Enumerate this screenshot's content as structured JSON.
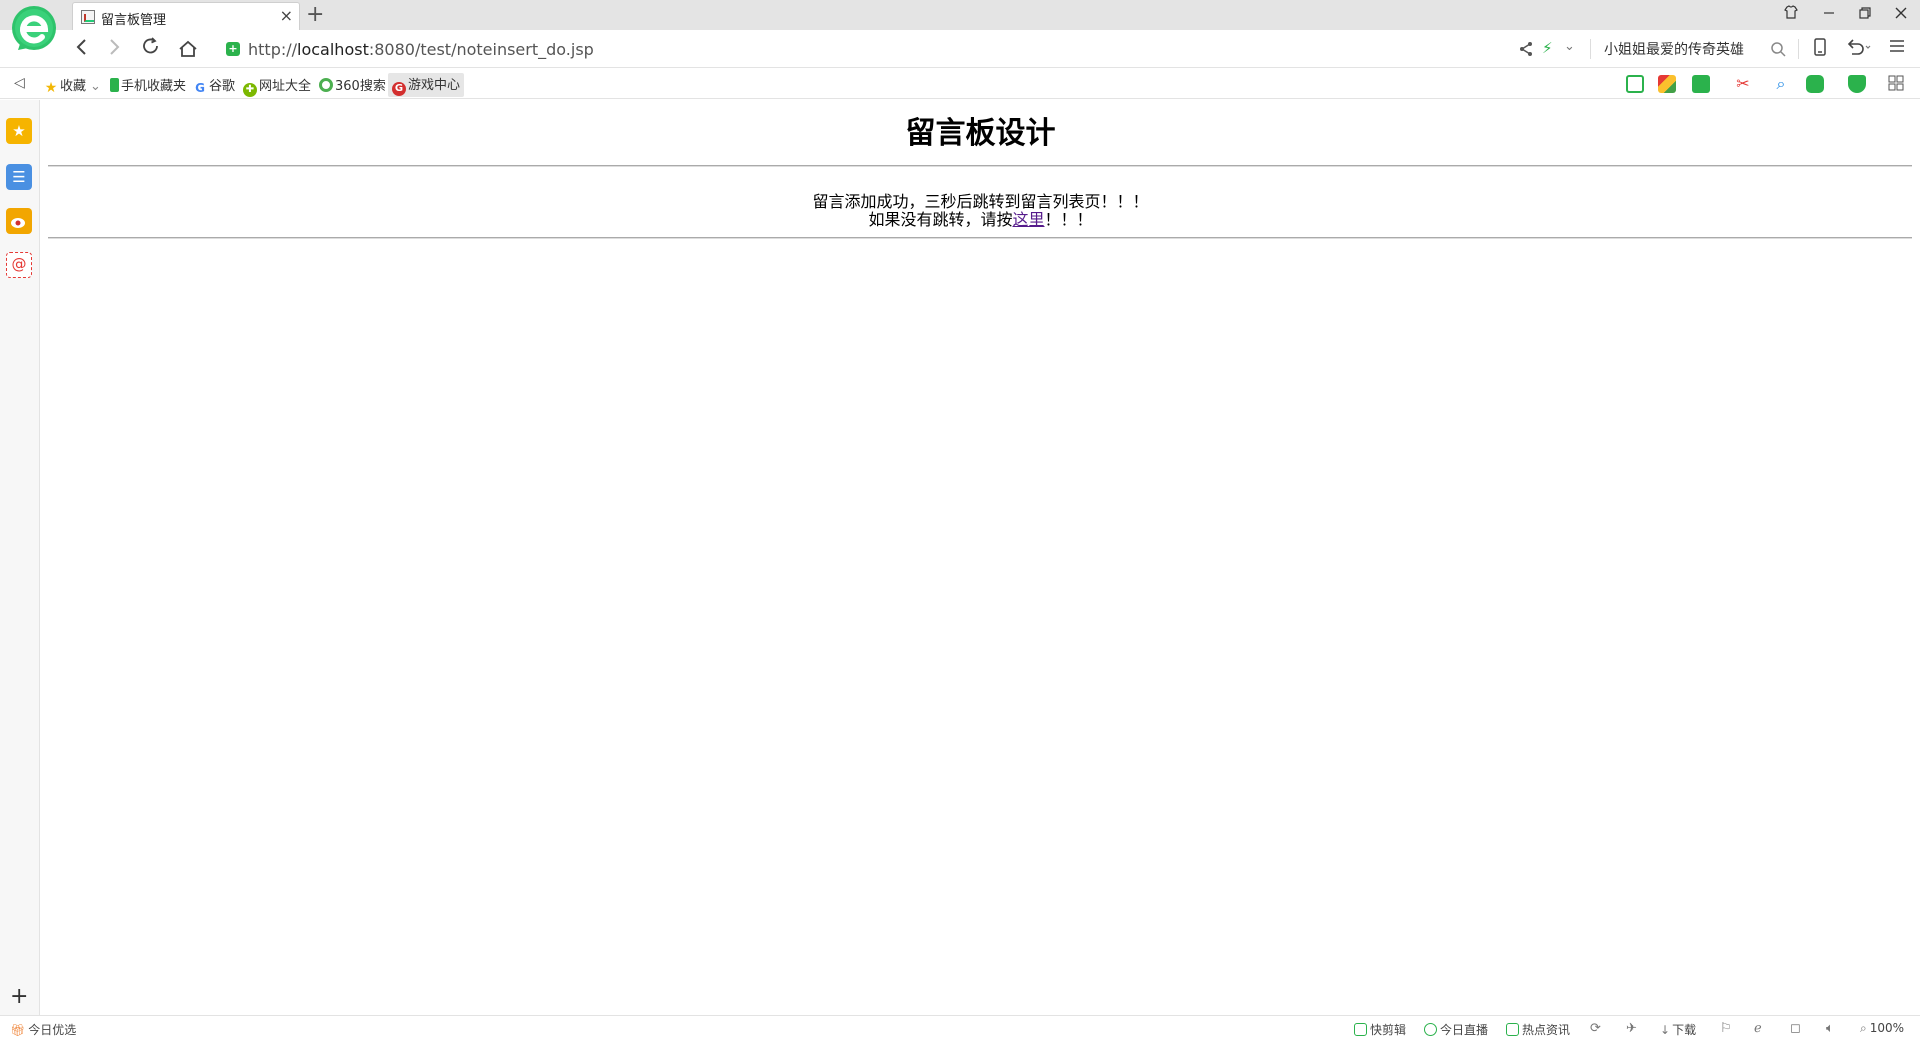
{
  "browser": {
    "tab_title": "留言板管理",
    "tab_close": "×",
    "new_tab": "+",
    "url_prefix": "http://",
    "url_host": "localhost",
    "url_rest": ":8080/test/noteinsert_do.jsp",
    "search_text": "小姐姐最爱的传奇英雄",
    "accent_color": "#2bb24c"
  },
  "bookmarks": {
    "items": [
      "收藏",
      "手机收藏夹",
      "谷歌",
      "网址大全",
      "360搜索",
      "游戏中心"
    ]
  },
  "page": {
    "title": "留言板设计",
    "message_line1": "留言添加成功，三秒后跳转到留言列表页！！！",
    "message_line2_before": "如果没有跳转，请按",
    "message_link": "这里",
    "message_line2_after": "！！！"
  },
  "statusbar": {
    "left": "今日优选",
    "items": [
      "快剪辑",
      "今日直播",
      "热点资讯"
    ],
    "download": "下载",
    "zoom": "100%"
  }
}
